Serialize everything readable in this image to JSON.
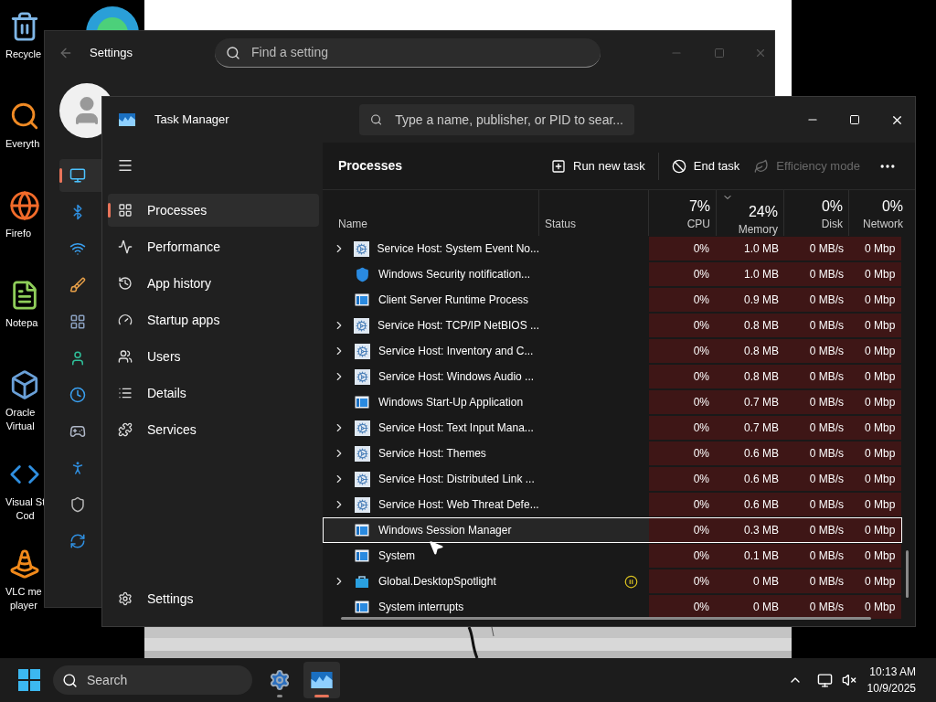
{
  "desktop": {
    "icons": [
      {
        "kind": "recycle",
        "lines": [
          "Recycle"
        ]
      },
      {
        "kind": "everything",
        "lines": [
          "Everyth"
        ]
      },
      {
        "kind": "firefox",
        "lines": [
          "Firefo"
        ]
      },
      {
        "kind": "notepad",
        "lines": [
          "Notepa"
        ]
      },
      {
        "kind": "virtualbox",
        "lines": [
          "Oracle",
          "Virtual"
        ]
      },
      {
        "kind": "vscode",
        "lines": [
          "Visual St",
          "Cod"
        ]
      },
      {
        "kind": "vlc",
        "lines": [
          "VLC me",
          "player"
        ]
      }
    ]
  },
  "settings_window": {
    "title": "Settings",
    "search": {
      "placeholder": "Find a setting"
    },
    "nav": [
      {
        "kind": "system",
        "selected": true
      },
      {
        "kind": "bluetooth",
        "selected": false
      },
      {
        "kind": "network",
        "selected": false
      },
      {
        "kind": "personalization",
        "selected": false
      },
      {
        "kind": "apps",
        "selected": false
      },
      {
        "kind": "accounts",
        "selected": false
      },
      {
        "kind": "time",
        "selected": false
      },
      {
        "kind": "gaming",
        "selected": false
      },
      {
        "kind": "accessibility",
        "selected": false
      },
      {
        "kind": "privacy",
        "selected": false
      },
      {
        "kind": "update",
        "selected": false
      }
    ]
  },
  "task_manager": {
    "title": "Task Manager",
    "search": {
      "placeholder": "Type a name, publisher, or PID to sear..."
    },
    "nav": [
      {
        "kind": "processes",
        "label": "Processes",
        "selected": true
      },
      {
        "kind": "performance",
        "label": "Performance",
        "selected": false
      },
      {
        "kind": "history",
        "label": "App history",
        "selected": false
      },
      {
        "kind": "startup",
        "label": "Startup apps",
        "selected": false
      },
      {
        "kind": "users",
        "label": "Users",
        "selected": false
      },
      {
        "kind": "details",
        "label": "Details",
        "selected": false
      },
      {
        "kind": "services",
        "label": "Services",
        "selected": false
      }
    ],
    "settings_label": "Settings",
    "page_title": "Processes",
    "toolbar": [
      {
        "kind": "run",
        "label": "Run new task",
        "disabled": false
      },
      {
        "kind": "end",
        "label": "End task",
        "disabled": false
      },
      {
        "kind": "efficiency",
        "label": "Efficiency mode",
        "disabled": true
      }
    ],
    "columns": [
      {
        "label": "Name",
        "sorted": false
      },
      {
        "label": "Status",
        "sorted": false
      },
      {
        "label": "CPU",
        "summary": "7%",
        "sorted": false
      },
      {
        "label": "Memory",
        "summary": "24%",
        "sorted": true
      },
      {
        "label": "Disk",
        "summary": "0%",
        "sorted": false
      },
      {
        "label": "Network",
        "summary": "0%",
        "sorted": false
      }
    ],
    "rows": [
      {
        "name": "Service Host: System Event No...",
        "kind": "service",
        "expandable": true,
        "suspended": false,
        "selected": false,
        "cpu": "0%",
        "memory": "1.0 MB",
        "disk": "0 MB/s",
        "network": "0 Mbp"
      },
      {
        "name": "Windows Security notification...",
        "kind": "shield",
        "expandable": false,
        "suspended": false,
        "selected": false,
        "cpu": "0%",
        "memory": "1.0 MB",
        "disk": "0 MB/s",
        "network": "0 Mbp"
      },
      {
        "name": "Client Server Runtime Process",
        "kind": "app",
        "expandable": false,
        "suspended": false,
        "selected": false,
        "cpu": "0%",
        "memory": "0.9 MB",
        "disk": "0 MB/s",
        "network": "0 Mbp"
      },
      {
        "name": "Service Host: TCP/IP NetBIOS ...",
        "kind": "service",
        "expandable": true,
        "suspended": false,
        "selected": false,
        "cpu": "0%",
        "memory": "0.8 MB",
        "disk": "0 MB/s",
        "network": "0 Mbp"
      },
      {
        "name": "Service Host: Inventory and C...",
        "kind": "service",
        "expandable": true,
        "suspended": false,
        "selected": false,
        "cpu": "0%",
        "memory": "0.8 MB",
        "disk": "0 MB/s",
        "network": "0 Mbp"
      },
      {
        "name": "Service Host: Windows Audio ...",
        "kind": "service",
        "expandable": true,
        "suspended": false,
        "selected": false,
        "cpu": "0%",
        "memory": "0.8 MB",
        "disk": "0 MB/s",
        "network": "0 Mbp"
      },
      {
        "name": "Windows Start-Up Application",
        "kind": "app",
        "expandable": false,
        "suspended": false,
        "selected": false,
        "cpu": "0%",
        "memory": "0.7 MB",
        "disk": "0 MB/s",
        "network": "0 Mbp"
      },
      {
        "name": "Service Host: Text Input Mana...",
        "kind": "service",
        "expandable": true,
        "suspended": false,
        "selected": false,
        "cpu": "0%",
        "memory": "0.7 MB",
        "disk": "0 MB/s",
        "network": "0 Mbp"
      },
      {
        "name": "Service Host: Themes",
        "kind": "service",
        "expandable": true,
        "suspended": false,
        "selected": false,
        "cpu": "0%",
        "memory": "0.6 MB",
        "disk": "0 MB/s",
        "network": "0 Mbp"
      },
      {
        "name": "Service Host: Distributed Link ...",
        "kind": "service",
        "expandable": true,
        "suspended": false,
        "selected": false,
        "cpu": "0%",
        "memory": "0.6 MB",
        "disk": "0 MB/s",
        "network": "0 Mbp"
      },
      {
        "name": "Service Host: Web Threat Defe...",
        "kind": "service",
        "expandable": true,
        "suspended": false,
        "selected": false,
        "cpu": "0%",
        "memory": "0.6 MB",
        "disk": "0 MB/s",
        "network": "0 Mbp"
      },
      {
        "name": "Windows Session Manager",
        "kind": "app",
        "expandable": false,
        "suspended": false,
        "selected": true,
        "cpu": "0%",
        "memory": "0.3 MB",
        "disk": "0 MB/s",
        "network": "0 Mbp"
      },
      {
        "name": "System",
        "kind": "app",
        "expandable": false,
        "suspended": false,
        "selected": false,
        "cpu": "0%",
        "memory": "0.1 MB",
        "disk": "0 MB/s",
        "network": "0 Mbp"
      },
      {
        "name": "Global.DesktopSpotlight",
        "kind": "store",
        "expandable": true,
        "suspended": true,
        "selected": false,
        "cpu": "0%",
        "memory": "0 MB",
        "disk": "0 MB/s",
        "network": "0 Mbp"
      },
      {
        "name": "System interrupts",
        "kind": "app",
        "expandable": false,
        "suspended": false,
        "selected": false,
        "cpu": "0%",
        "memory": "0 MB",
        "disk": "0 MB/s",
        "network": "0 Mbp"
      }
    ]
  },
  "taskbar": {
    "search": {
      "placeholder": "Search"
    },
    "apps": [
      {
        "kind": "settings",
        "active": false
      },
      {
        "kind": "task-manager",
        "active": true
      }
    ],
    "time": "10:13 AM",
    "date": "10/9/2025"
  }
}
